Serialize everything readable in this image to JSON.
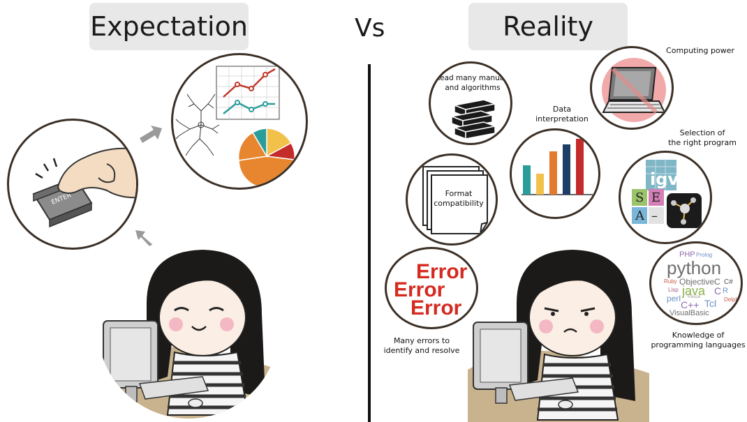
{
  "headings": {
    "left": "Expectation",
    "vs": "Vs",
    "right": "Reality"
  },
  "left": {
    "enter_key": "ENTER"
  },
  "right": {
    "labels": {
      "manuals": [
        "Read many manuals",
        "and algorithms"
      ],
      "data": [
        "Data",
        "interpretation"
      ],
      "computing": "Computing power",
      "selection": [
        "Selection of",
        "the right program"
      ],
      "format": [
        "Format",
        "compatibility"
      ],
      "errors": [
        "Many errors to",
        "identify and resolve"
      ],
      "languages": [
        "Knowledge of",
        "programming languages"
      ]
    },
    "error_words": [
      "Error",
      "Error",
      "Error"
    ],
    "software_tiles": {
      "igv": "igv",
      "s": "S",
      "e": "E",
      "a": "A",
      "dash": "–"
    },
    "language_cloud": [
      "PHP",
      "Prolog",
      "python",
      "Ruby",
      "ObjectiveC",
      "C#",
      "Lisp",
      "java",
      "C",
      "R",
      "perl",
      "Pascal",
      "C++",
      "Tcl",
      "Delphi",
      "VisualBasic"
    ]
  },
  "colors": {
    "error_red": "#d42a20",
    "outline": "#3b3027",
    "bar_teal": "#2a9d9a",
    "bar_yellow": "#f2c14a",
    "bar_orange": "#e47b2c",
    "bar_navy": "#1d3e66",
    "bar_red": "#c42b2b"
  }
}
